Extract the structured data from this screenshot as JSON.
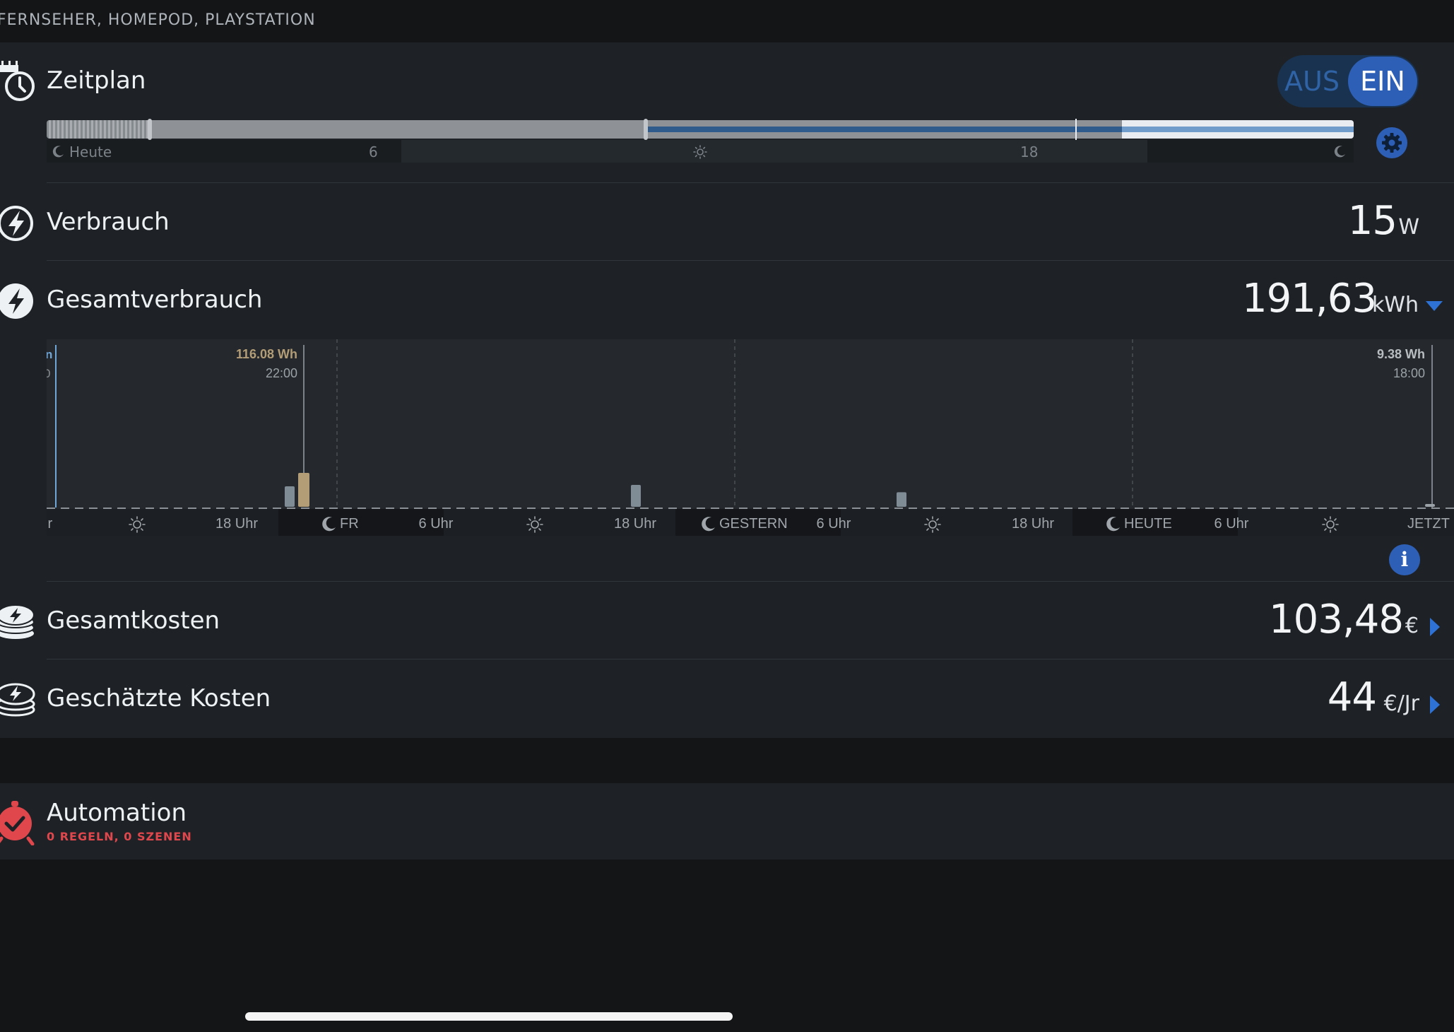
{
  "header": {
    "title": "FERNSEHER, HOMEPOD, PLAYSTATION"
  },
  "schedule": {
    "label": "Zeitplan",
    "toggle": {
      "off_label": "AUS",
      "on_label": "EIN",
      "state": "on"
    },
    "timeline_labels": [
      "Heute",
      "6",
      "18"
    ],
    "icons": [
      "calendar-clock-icon",
      "moon-icon",
      "sun-icon",
      "gear-icon"
    ]
  },
  "consumption": {
    "label": "Verbrauch",
    "value": "15",
    "unit": "W",
    "icon": "lightning-icon"
  },
  "total_consumption": {
    "label": "Gesamtverbrauch",
    "value": "191,63",
    "unit": "kWh",
    "icon": "lightning-filled-icon",
    "expand_icon": "chevron-down-icon"
  },
  "chart_data": {
    "type": "bar",
    "x_labels": [
      "ır",
      "18 Uhr",
      "FR",
      "6 Uhr",
      "18 Uhr",
      "GESTERN",
      "6 Uhr",
      "18 Uhr",
      "HEUTE",
      "6 Uhr",
      "JETZT"
    ],
    "bars": [
      {
        "time": "FR 20:00",
        "value": 70
      },
      {
        "time": "FR 22:00",
        "value": 116.08,
        "highlight": true
      },
      {
        "time": "SA 18:00",
        "value": 75
      },
      {
        "time": "GESTERN 9:00",
        "value": 50
      },
      {
        "time": "HEUTE 18:00",
        "value": 9.38
      }
    ],
    "annotations": [
      {
        "value": "116.08 Wh",
        "time": "22:00"
      },
      {
        "value": "9.38 Wh",
        "time": "18:00"
      }
    ],
    "edge_marks": [
      "n",
      "0"
    ],
    "colors": {
      "highlight": "#b39d76",
      "normal": "#7f8b95",
      "accent": "#5f94c2"
    }
  },
  "total_costs": {
    "label": "Gesamtkosten",
    "value": "103,48",
    "unit": "€",
    "icon": "coins-icon"
  },
  "estimated_costs": {
    "label": "Geschätzte Kosten",
    "value": "44",
    "unit": "€/Jr",
    "icon": "coins-icon"
  },
  "automation": {
    "label": "Automation",
    "subtitle": "0 REGELN, 0 SZENEN",
    "icon": "alarm-clock-icon",
    "color": "#e0474c"
  }
}
